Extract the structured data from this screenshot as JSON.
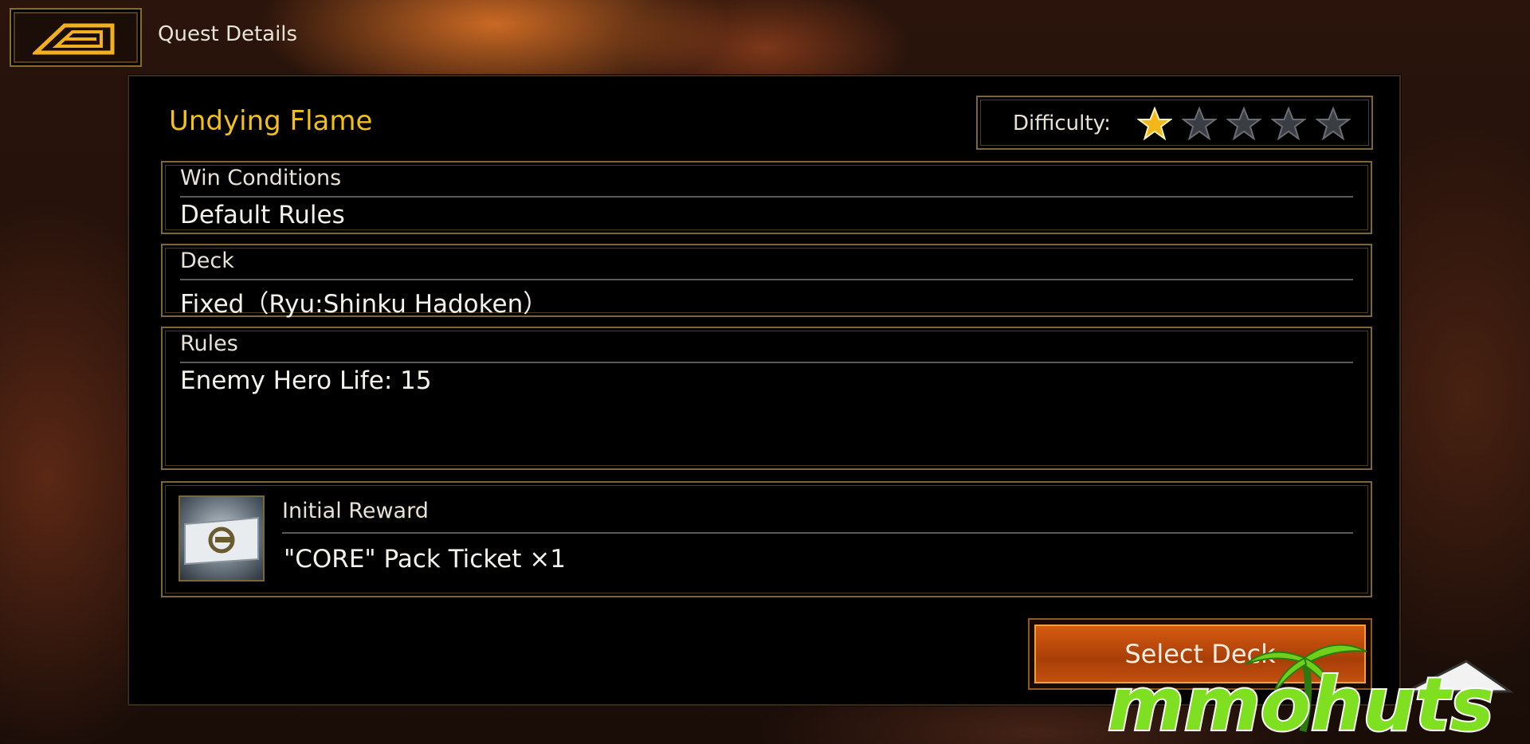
{
  "header": {
    "back_icon": "back-arrow-icon",
    "title": "Quest Details"
  },
  "quest": {
    "name": "Undying Flame",
    "difficulty_label": "Difficulty:",
    "difficulty_rating": 1,
    "difficulty_max": 5
  },
  "sections": {
    "win_conditions": {
      "label": "Win Conditions",
      "value": "Default Rules"
    },
    "deck": {
      "label": "Deck",
      "value": "Fixed（Ryu:Shinku Hadoken）"
    },
    "rules": {
      "label": "Rules",
      "value": "Enemy Hero Life: 15"
    }
  },
  "reward": {
    "label": "Initial Reward",
    "value": "\"CORE\" Pack Ticket ×1",
    "icon": "pack-ticket-icon"
  },
  "actions": {
    "select_deck_label": "Select Deck"
  },
  "watermark": {
    "text": "mmohuts"
  },
  "colors": {
    "accent_gold": "#f2c018",
    "frame": "#7a6638",
    "button_orange": "#c24a0c"
  }
}
